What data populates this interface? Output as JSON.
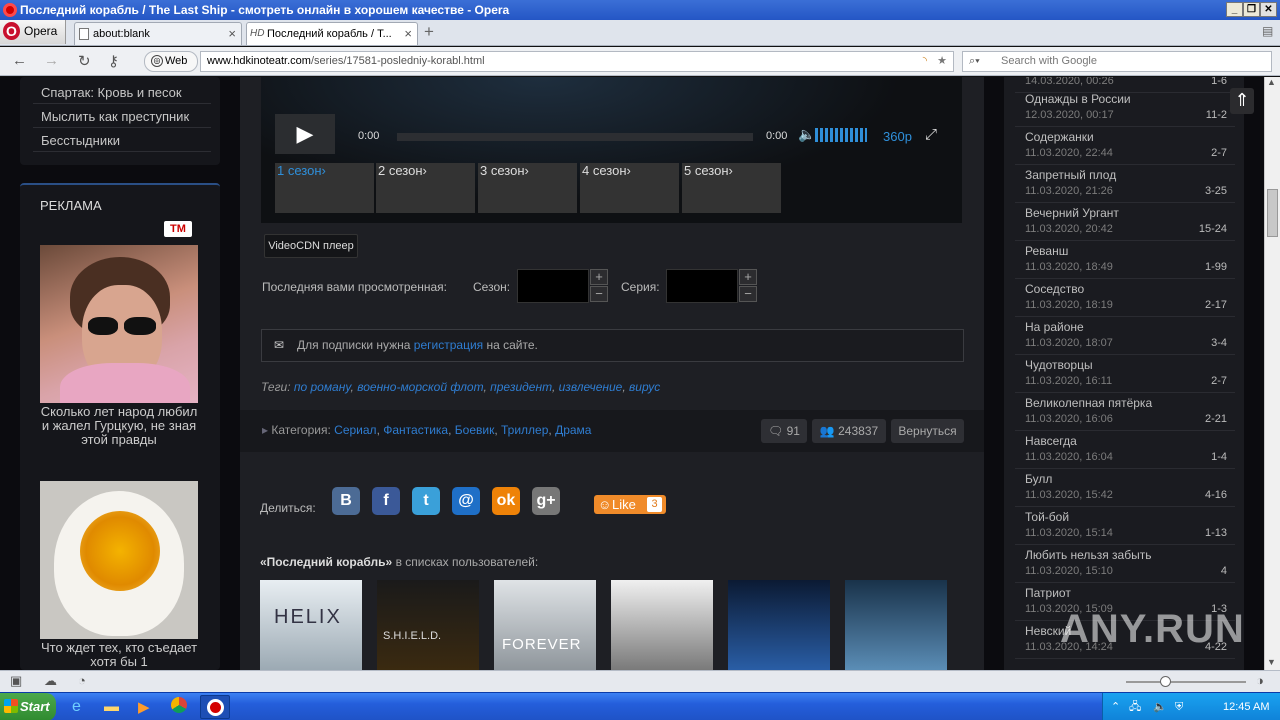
{
  "window": {
    "title": "Последний корабль / The Last Ship - смотреть онлайн в хорошем качестве - Opera",
    "opera_label": "Opera"
  },
  "tabs": [
    {
      "label": "about:blank"
    },
    {
      "label": "Последний корабль / T..."
    }
  ],
  "tab_favicon_text": "HD",
  "navbar": {
    "web_label": "Web",
    "url_domain": "www.hdkinoteatr.com",
    "url_path": "/series/17581-posledniy-korabl.html",
    "search_placeholder": "Search with Google"
  },
  "left": {
    "menu": [
      "Спартак: Кровь и песок",
      "Мыслить как преступник",
      "Бесстыдники"
    ],
    "ad_title": "РЕКЛАМА",
    "ad_badge": "TM",
    "ad1_caption": "Сколько лет народ любил и жалел Гурцкую, не зная этой правды",
    "ad2_caption": "Что ждет тех, кто съедает хотя бы 1"
  },
  "player": {
    "time_start": "0:00",
    "time_end": "0:00",
    "quality": "360p",
    "seasons": [
      "1 сезон",
      "2 сезон",
      "3 сезон",
      "4 сезон",
      "5 сезон"
    ],
    "active_season": 0
  },
  "videocdn_label": "VideoCDN плеер",
  "last_watched": {
    "label": "Последняя вами просмотренная:",
    "season_label": "Сезон:",
    "episode_label": "Серия:"
  },
  "subscribe": {
    "before": "Для подписки нужна",
    "link": "регистрация",
    "after": "на сайте."
  },
  "tags": {
    "label": "Теги:",
    "items": [
      "по роману",
      "военно-морской флот",
      "президент",
      "извлечение",
      "вирус"
    ]
  },
  "category": {
    "label": "Категория:",
    "items": [
      "Сериал",
      "Фантастика",
      "Боевик",
      "Триллер",
      "Драма"
    ],
    "comments": "91",
    "views": "243837",
    "back": "Вернуться"
  },
  "share": {
    "label": "Делиться:",
    "like_label": "Like",
    "like_count": "3"
  },
  "user_lists": {
    "title_bold": "«Последний корабль»",
    "title_rest": "в списках пользователей:",
    "posters": [
      "HELIX",
      "S.H.I.E.L.D.",
      "FOREVER",
      "",
      "",
      ""
    ]
  },
  "recent": [
    {
      "title": "",
      "date": "14.03.2020, 00:26",
      "ep": "1-6"
    },
    {
      "title": "Однажды в России",
      "date": "12.03.2020, 00:17",
      "ep": "11-2"
    },
    {
      "title": "Содержанки",
      "date": "11.03.2020, 22:44",
      "ep": "2-7"
    },
    {
      "title": "Запретный плод",
      "date": "11.03.2020, 21:26",
      "ep": "3-25"
    },
    {
      "title": "Вечерний Ургант",
      "date": "11.03.2020, 20:42",
      "ep": "15-24"
    },
    {
      "title": "Реванш",
      "date": "11.03.2020, 18:49",
      "ep": "1-99"
    },
    {
      "title": "Соседство",
      "date": "11.03.2020, 18:19",
      "ep": "2-17"
    },
    {
      "title": "На районе",
      "date": "11.03.2020, 18:07",
      "ep": "3-4"
    },
    {
      "title": "Чудотворцы",
      "date": "11.03.2020, 16:11",
      "ep": "2-7"
    },
    {
      "title": "Великолепная пятёрка",
      "date": "11.03.2020, 16:06",
      "ep": "2-21"
    },
    {
      "title": "Навсегда",
      "date": "11.03.2020, 16:04",
      "ep": "1-4"
    },
    {
      "title": "Булл",
      "date": "11.03.2020, 15:42",
      "ep": "4-16"
    },
    {
      "title": "Той-бой",
      "date": "11.03.2020, 15:14",
      "ep": "1-13"
    },
    {
      "title": "Любить нельзя забыть",
      "date": "11.03.2020, 15:10",
      "ep": "4"
    },
    {
      "title": "Патриот",
      "date": "11.03.2020, 15:09",
      "ep": "1-3"
    },
    {
      "title": "Невский",
      "date": "11.03.2020, 14:24",
      "ep": "4-22"
    }
  ],
  "watermark": "ANY.RUN",
  "taskbar": {
    "start_label": "Start",
    "clock": "12:45 AM"
  }
}
